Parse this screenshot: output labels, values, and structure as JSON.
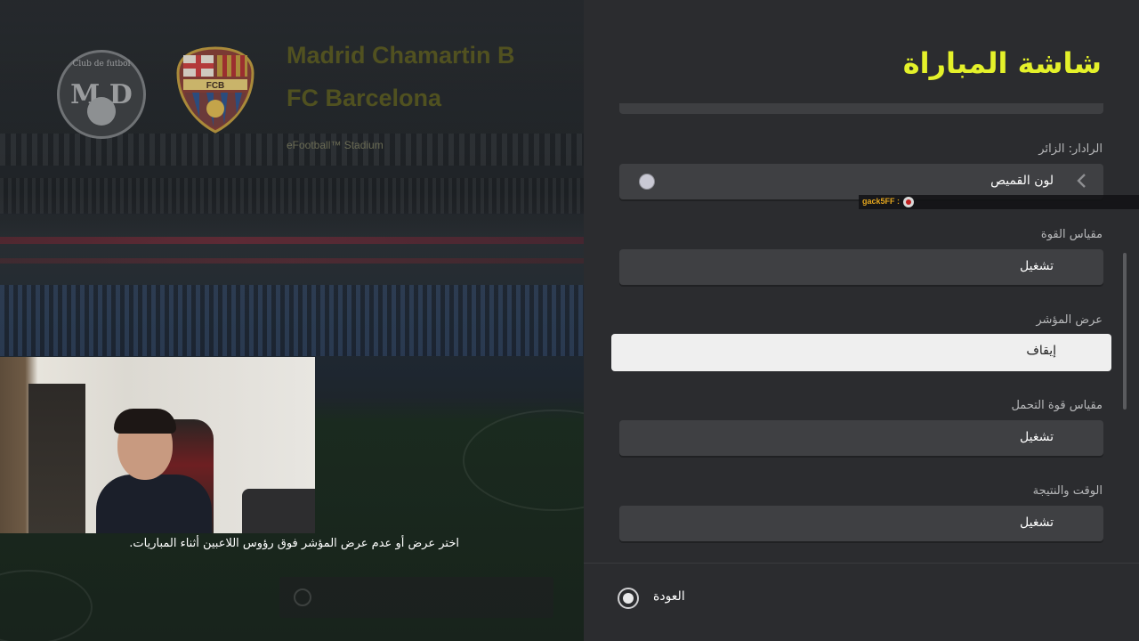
{
  "match": {
    "team_home": "Madrid Chamartin B",
    "team_away": "FC Barcelona",
    "stadium": "eFootball™ Stadium",
    "home_logo_text": "M D",
    "home_logo_caption": "Club de futbol",
    "away_crest_text": "FCB"
  },
  "hint": {
    "text": "اختر عرض أو عدم عرض المؤشر فوق رؤوس اللاعبين أثناء المباريات."
  },
  "panel": {
    "title": "شاشة المباراة",
    "settings": [
      {
        "label": "الرادار: الزائر",
        "value": "لون القميص"
      },
      {
        "label": "مقياس القوة",
        "value": "تشغيل"
      },
      {
        "label": "عرض المؤشر",
        "value": "إيقاف"
      },
      {
        "label": "مقياس قوة التحمل",
        "value": "تشغيل"
      },
      {
        "label": "الوقت والنتيجة",
        "value": "تشغيل"
      }
    ],
    "back_label": "العودة"
  },
  "chat": {
    "username": "gack5FF :"
  },
  "colors": {
    "title_accent": "#e4f12a",
    "panel_bg": "#2b2c2f",
    "field_bg": "#3f4043",
    "selected_bg": "#efefef",
    "chat_name": "#e3a51e"
  },
  "icons": {
    "color_swatch": "color-dot-icon",
    "arrow": "chevron-left-icon",
    "back": "circle-button-icon",
    "chat": "chat-avatar-icon"
  }
}
